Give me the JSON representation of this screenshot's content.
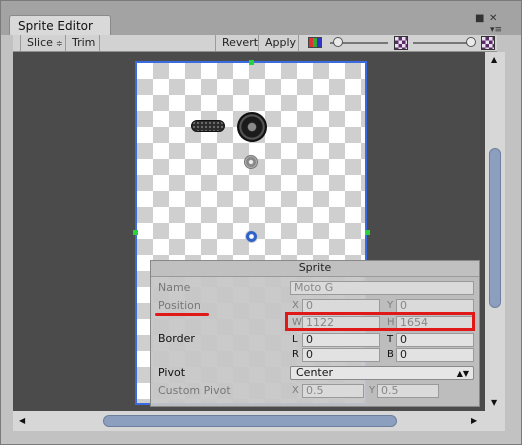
{
  "window": {
    "tab_title": "Sprite Editor"
  },
  "toolbar": {
    "slice_label": "Slice",
    "slice_arrow": "≑",
    "trim_label": "Trim",
    "revert_label": "Revert",
    "apply_label": "Apply",
    "zoom_level": 0.14,
    "mip_level": 0.93
  },
  "sprite_panel": {
    "title": "Sprite",
    "name_label": "Name",
    "name_value": "Moto G",
    "position_label": "Position",
    "x_label": "X",
    "x_value": "0",
    "y_label": "Y",
    "y_value": "0",
    "w_label": "W",
    "w_value": "1122",
    "h_label": "H",
    "h_value": "1654",
    "border_label": "Border",
    "l_label": "L",
    "l_value": "0",
    "t_label": "T",
    "t_value": "0",
    "r_label": "R",
    "r_value": "0",
    "b_label": "B",
    "b_value": "0",
    "pivot_label": "Pivot",
    "pivot_value": "Center",
    "custom_pivot_label": "Custom Pivot",
    "custom_x_label": "X",
    "custom_x_value": "0.5",
    "custom_y_label": "Y",
    "custom_y_value": "0.5"
  },
  "colors": {
    "sprite_border": "#3a6be0",
    "handle": "#29d23a",
    "annotation": "#e01818",
    "scroll_thumb": "#8c9fbe"
  },
  "icons": [
    "lock-icon",
    "close-icon",
    "menu-icon",
    "color-channel-icon",
    "mipmap-icon"
  ]
}
